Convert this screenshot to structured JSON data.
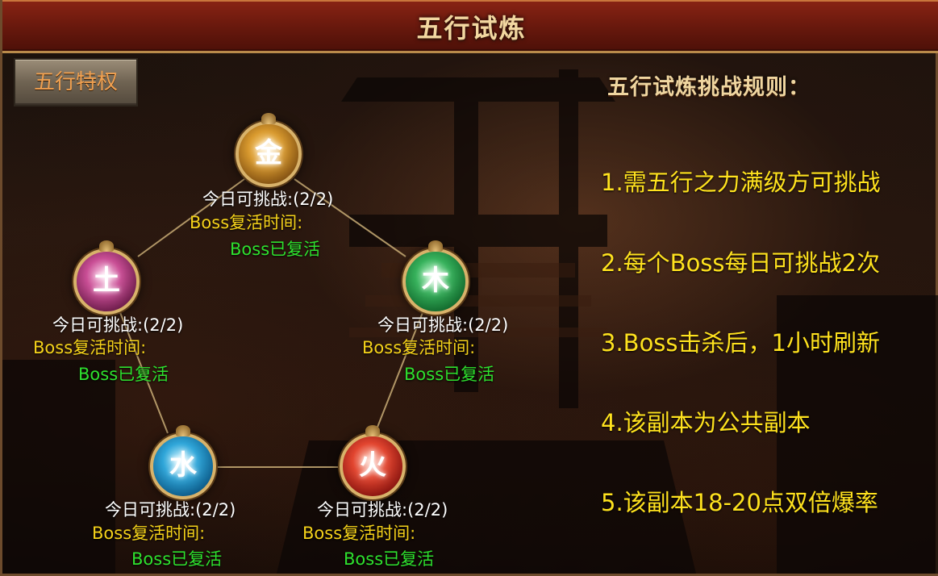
{
  "title": "五行试炼",
  "privilege_button": "五行特权",
  "rules_title": "五行试炼挑战规则：",
  "rules": [
    "1.需五行之力满级方可挑战",
    "2.每个Boss每日可挑战2次",
    "3.Boss击杀后，1小时刷新",
    "4.该副本为公共副本",
    "5.该副本18-20点双倍爆率"
  ],
  "nodes": {
    "metal": {
      "glyph": "金",
      "attempts": "今日可挑战:(2/2)",
      "revive_label": "Boss复活时间:",
      "revive_status": "Boss已复活"
    },
    "wood": {
      "glyph": "木",
      "attempts": "今日可挑战:(2/2)",
      "revive_label": "Boss复活时间:",
      "revive_status": "Boss已复活"
    },
    "earth": {
      "glyph": "土",
      "attempts": "今日可挑战:(2/2)",
      "revive_label": "Boss复活时间:",
      "revive_status": "Boss已复活"
    },
    "water": {
      "glyph": "水",
      "attempts": "今日可挑战:(2/2)",
      "revive_label": "Boss复活时间:",
      "revive_status": "Boss已复活"
    },
    "fire": {
      "glyph": "火",
      "attempts": "今日可挑战:(2/2)",
      "revive_label": "Boss复活时间:",
      "revive_status": "Boss已复活"
    }
  },
  "colors": {
    "title_bar": "#6d1a0e",
    "attempts_text": "#ffffff",
    "revive_label_text": "#f5d21a",
    "revive_status_text": "#2ee02e",
    "rules_text": "#ffe21e",
    "privilege_text": "#f0a050"
  }
}
